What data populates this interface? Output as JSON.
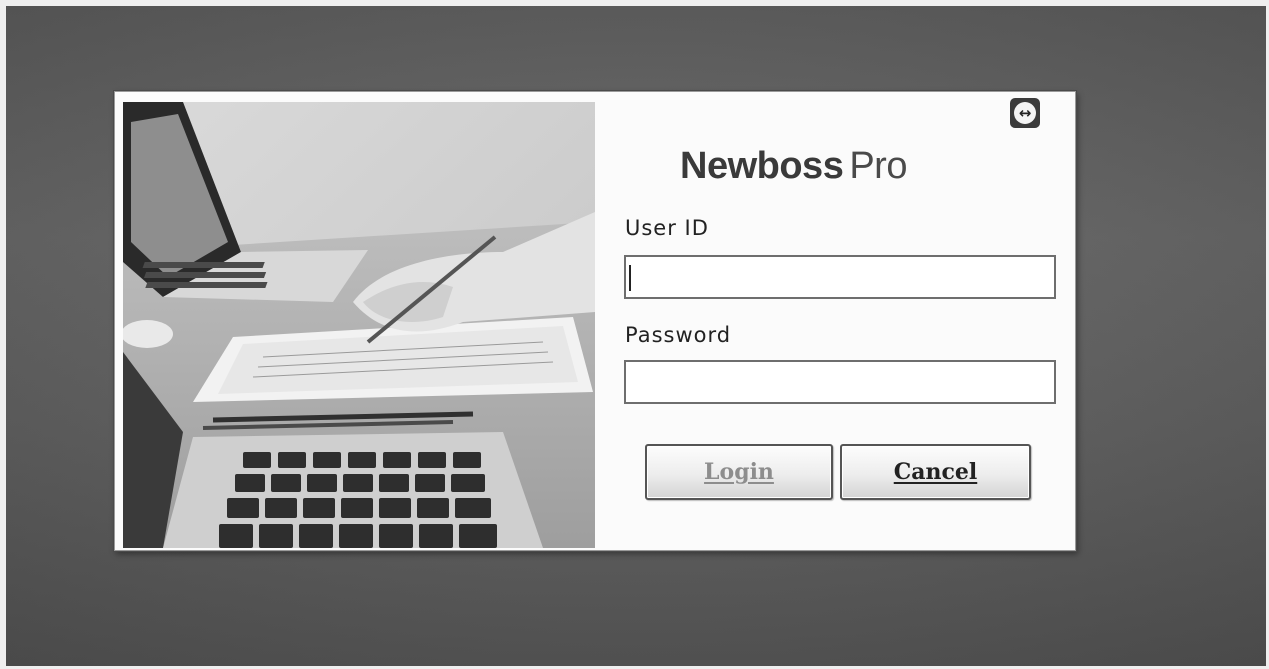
{
  "brand": {
    "name_bold": "Newboss",
    "name_light": "Pro"
  },
  "form": {
    "user_id_label": "User ID",
    "user_id_value": "",
    "password_label": "Password",
    "password_value": ""
  },
  "buttons": {
    "login_label": "Login",
    "cancel_label": "Cancel"
  },
  "icons": {
    "corner_icon": "teamviewer-icon"
  },
  "colors": {
    "desktop_background": "#606060",
    "dialog_background": "#fbfbfb",
    "brand_text": "#3a3a3a",
    "disabled_text": "#8d8d8d"
  }
}
